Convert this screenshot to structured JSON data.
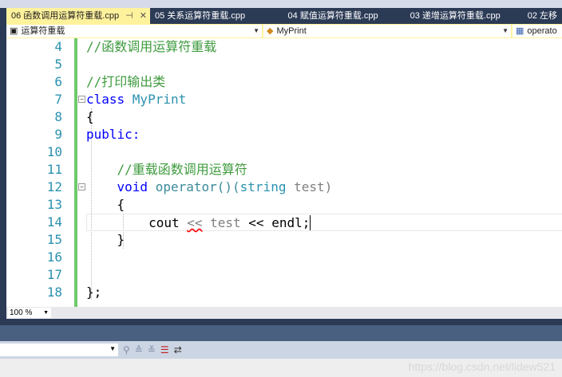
{
  "tabs": [
    {
      "label": "06 函数调用运算符重载.cpp",
      "active": true
    },
    {
      "label": "05 关系运算符重载.cpp"
    },
    {
      "label": "04 赋值运算符重载.cpp"
    },
    {
      "label": "03 递增运算符重载.cpp"
    },
    {
      "label": "02 左移"
    }
  ],
  "nav": {
    "project": "运算符重载",
    "class": "MyPrint",
    "member": "operato"
  },
  "line_numbers": [
    "4",
    "5",
    "6",
    "7",
    "8",
    "9",
    "10",
    "11",
    "12",
    "13",
    "14",
    "15",
    "16",
    "17",
    "18"
  ],
  "code": {
    "l4": "//函数调用运算符重载",
    "l6": "//打印输出类",
    "l7a": "class ",
    "l7b": "MyPrint",
    "l8": "{",
    "l9": "public:",
    "l11": "    //重载函数调用运算符",
    "l12a": "    ",
    "l12b": "void",
    "l12c": " operator()(",
    "l12d": "string",
    "l12e": " test)",
    "l13": "    {",
    "l14a": "        cout ",
    "l14b": "<<",
    "l14c": " test ",
    "l14d": "<< endl;",
    "l15": "    }",
    "l18": "};"
  },
  "zoom": "100 %",
  "watermark": "https://blog.csdn.net/lidew521"
}
